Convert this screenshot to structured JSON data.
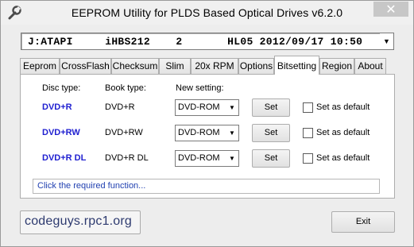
{
  "window": {
    "title": "EEPROM Utility for PLDS Based Optical Drives v6.2.0",
    "close_glyph": "✕"
  },
  "drive": {
    "selected": "J:ATAPI     iHBS212    2       HL05 2012/09/17 10:50",
    "arrow_glyph": "▼"
  },
  "tabs": [
    {
      "label": "Eeprom",
      "active": false
    },
    {
      "label": "CrossFlash",
      "active": false
    },
    {
      "label": "Checksum",
      "active": false
    },
    {
      "label": "Slim",
      "active": false
    },
    {
      "label": "20x RPM",
      "active": false
    },
    {
      "label": "Options",
      "active": false
    },
    {
      "label": "Bitsetting",
      "active": true
    },
    {
      "label": "Region",
      "active": false
    },
    {
      "label": "About",
      "active": false
    }
  ],
  "bitsetting": {
    "headers": {
      "disc_type": "Disc type:",
      "book_type": "Book type:",
      "new_setting": "New setting:"
    },
    "rows": [
      {
        "disc": "DVD+R",
        "book": "DVD+R",
        "setting": "DVD-ROM",
        "set": "Set",
        "default_label": "Set as default"
      },
      {
        "disc": "DVD+RW",
        "book": "DVD+RW",
        "setting": "DVD-ROM",
        "set": "Set",
        "default_label": "Set as default"
      },
      {
        "disc": "DVD+R DL",
        "book": "DVD+R DL",
        "setting": "DVD-ROM",
        "set": "Set",
        "default_label": "Set as default"
      }
    ],
    "status": "Click the required function..."
  },
  "footer": {
    "site": "codeguys.rpc1.org",
    "exit": "Exit"
  },
  "icons": {
    "app": "wrench-icon",
    "dropdown": "chevron-down-icon"
  },
  "colors": {
    "disc_text": "#1f1fd0",
    "status_text": "#1f3fb0",
    "site_text": "#2d3a6f"
  }
}
